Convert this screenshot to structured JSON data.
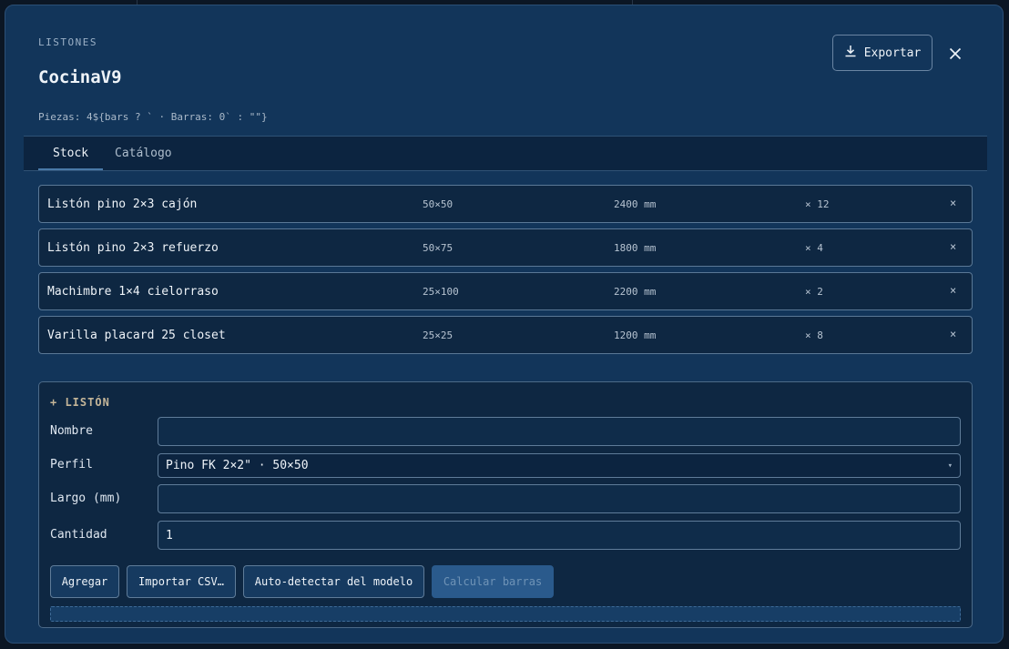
{
  "header": {
    "eyebrow": "LISTONES",
    "title": "CocinaV9",
    "subtitle": "Piezas: 4${bars ? ` · Barras: 0` : \"\"}",
    "export_label": "Exportar"
  },
  "tabs": [
    {
      "label": "Stock",
      "active": true
    },
    {
      "label": "Catálogo",
      "active": false
    }
  ],
  "stock": [
    {
      "name": "Listón pino 2×3 cajón",
      "profile": "50×50",
      "length": "2400 mm",
      "qty": "× 12",
      "remove": "×"
    },
    {
      "name": "Listón pino 2×3 refuerzo",
      "profile": "50×75",
      "length": "1800 mm",
      "qty": "× 4",
      "remove": "×"
    },
    {
      "name": "Machimbre 1×4 cielorraso",
      "profile": "25×100",
      "length": "2200 mm",
      "qty": "× 2",
      "remove": "×"
    },
    {
      "name": "Varilla placard 25 closet",
      "profile": "25×25",
      "length": "1200 mm",
      "qty": "× 8",
      "remove": "×"
    }
  ],
  "form": {
    "title": "+ LISTÓN",
    "nombre_label": "Nombre",
    "nombre_value": "",
    "perfil_label": "Perfil",
    "perfil_value": "Pino FK 2×2\" · 50×50",
    "largo_label": "Largo (mm)",
    "largo_value": "",
    "cantidad_label": "Cantidad",
    "cantidad_value": "1"
  },
  "actions": {
    "agregar": "Agregar",
    "importar": "Importar CSV…",
    "autodetect": "Auto-detectar del modelo",
    "calcular": "Calcular barras"
  },
  "icons": {
    "export": "download-icon",
    "close": "close-icon",
    "select_caret": "chevron-down-icon"
  },
  "colors": {
    "modal_bg": "#12355a",
    "accent": "#4a7aa8",
    "form_title": "#c4b598"
  }
}
